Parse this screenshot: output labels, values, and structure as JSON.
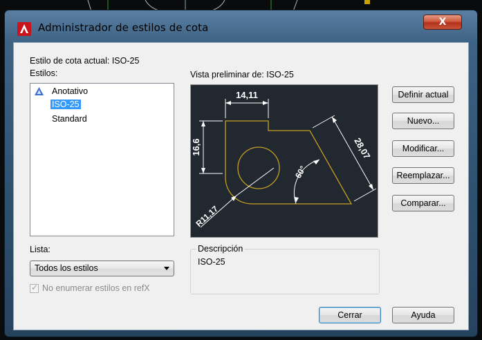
{
  "window": {
    "title": "Administrador de estilos de cota",
    "close_label": "X"
  },
  "current_style": "Estilo de cota actual: ISO-25",
  "styles_label": "Estilos:",
  "styles_list": [
    {
      "label": "Anotativo",
      "icon": "annotative-icon"
    },
    {
      "label": "ISO-25",
      "selected": true
    },
    {
      "label": "Standard"
    }
  ],
  "preview": {
    "label": "Vista preliminar de: ISO-25",
    "dim_top": "14,11",
    "dim_left": "16,6",
    "dim_right": "28,07",
    "dim_angle": "60°",
    "dim_radius": "R11,17"
  },
  "buttons": {
    "set_current": "Definir actual",
    "new": "Nuevo...",
    "modify": "Modificar...",
    "override": "Reemplazar...",
    "compare": "Comparar..."
  },
  "list_label": "Lista:",
  "list_filter_value": "Todos los estilos",
  "xref_checkbox_label": "No enumerar estilos en refX",
  "description": {
    "label": "Descripción",
    "text": "ISO-25"
  },
  "footer": {
    "close": "Cerrar",
    "help": "Ayuda"
  }
}
